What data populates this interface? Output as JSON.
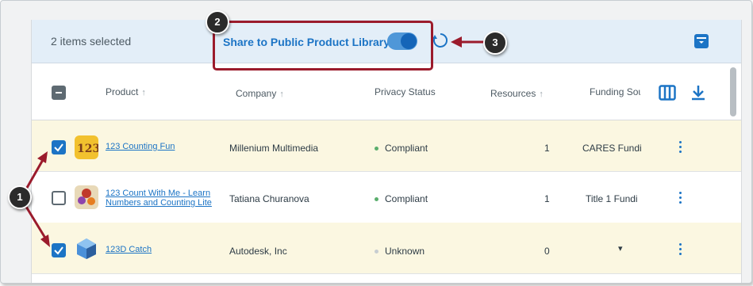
{
  "selection_bar": {
    "count_text": "2 items selected",
    "share_label": "Share to Public Product Library",
    "share_toggle_on": true
  },
  "table": {
    "headers": {
      "product": "Product",
      "company": "Company",
      "privacy": "Privacy Status",
      "resources": "Resources",
      "funding": "Funding Sou"
    },
    "sort_icon": "↑",
    "rows": [
      {
        "checked": true,
        "product": "123 Counting Fun",
        "company": "Millenium Multimedia",
        "privacy": "Compliant",
        "privacy_color": "#5aae6d",
        "resources": "1",
        "funding": "CARES Fundi"
      },
      {
        "checked": false,
        "product_line1": "123 Count With Me - Learn",
        "product_line2": "Numbers and Counting Lite",
        "company": "Tatiana Churanova",
        "privacy": "Compliant",
        "privacy_color": "#5aae6d",
        "resources": "1",
        "funding": "Title 1 Fundi"
      },
      {
        "checked": true,
        "product": "123D Catch",
        "company": "Autodesk, Inc",
        "privacy": "Unknown",
        "privacy_color": "#c7cdd1",
        "resources": "0",
        "funding_dropdown": "▾"
      }
    ]
  },
  "callouts": {
    "one": "1",
    "two": "2",
    "three": "3",
    "color": "#9b1b2c"
  },
  "icons": [
    "refresh-icon",
    "archive-icon",
    "columns-icon",
    "download-icon",
    "kebab-menu-icon",
    "sort-arrow-icon"
  ]
}
